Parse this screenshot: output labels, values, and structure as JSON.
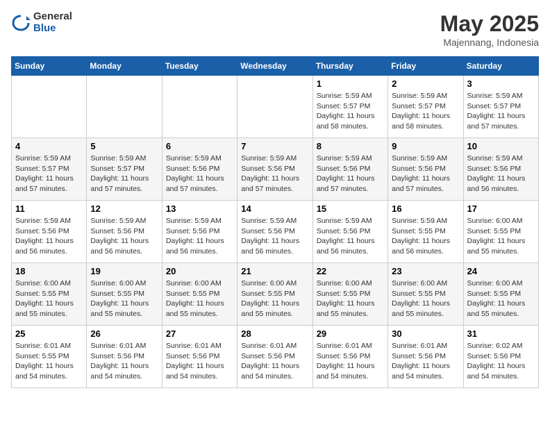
{
  "logo": {
    "general": "General",
    "blue": "Blue"
  },
  "header": {
    "month": "May 2025",
    "location": "Majennang, Indonesia"
  },
  "days_of_week": [
    "Sunday",
    "Monday",
    "Tuesday",
    "Wednesday",
    "Thursday",
    "Friday",
    "Saturday"
  ],
  "weeks": [
    [
      {
        "day": "",
        "info": ""
      },
      {
        "day": "",
        "info": ""
      },
      {
        "day": "",
        "info": ""
      },
      {
        "day": "",
        "info": ""
      },
      {
        "day": "1",
        "info": "Sunrise: 5:59 AM\nSunset: 5:57 PM\nDaylight: 11 hours\nand 58 minutes."
      },
      {
        "day": "2",
        "info": "Sunrise: 5:59 AM\nSunset: 5:57 PM\nDaylight: 11 hours\nand 58 minutes."
      },
      {
        "day": "3",
        "info": "Sunrise: 5:59 AM\nSunset: 5:57 PM\nDaylight: 11 hours\nand 57 minutes."
      }
    ],
    [
      {
        "day": "4",
        "info": "Sunrise: 5:59 AM\nSunset: 5:57 PM\nDaylight: 11 hours\nand 57 minutes."
      },
      {
        "day": "5",
        "info": "Sunrise: 5:59 AM\nSunset: 5:57 PM\nDaylight: 11 hours\nand 57 minutes."
      },
      {
        "day": "6",
        "info": "Sunrise: 5:59 AM\nSunset: 5:56 PM\nDaylight: 11 hours\nand 57 minutes."
      },
      {
        "day": "7",
        "info": "Sunrise: 5:59 AM\nSunset: 5:56 PM\nDaylight: 11 hours\nand 57 minutes."
      },
      {
        "day": "8",
        "info": "Sunrise: 5:59 AM\nSunset: 5:56 PM\nDaylight: 11 hours\nand 57 minutes."
      },
      {
        "day": "9",
        "info": "Sunrise: 5:59 AM\nSunset: 5:56 PM\nDaylight: 11 hours\nand 57 minutes."
      },
      {
        "day": "10",
        "info": "Sunrise: 5:59 AM\nSunset: 5:56 PM\nDaylight: 11 hours\nand 56 minutes."
      }
    ],
    [
      {
        "day": "11",
        "info": "Sunrise: 5:59 AM\nSunset: 5:56 PM\nDaylight: 11 hours\nand 56 minutes."
      },
      {
        "day": "12",
        "info": "Sunrise: 5:59 AM\nSunset: 5:56 PM\nDaylight: 11 hours\nand 56 minutes."
      },
      {
        "day": "13",
        "info": "Sunrise: 5:59 AM\nSunset: 5:56 PM\nDaylight: 11 hours\nand 56 minutes."
      },
      {
        "day": "14",
        "info": "Sunrise: 5:59 AM\nSunset: 5:56 PM\nDaylight: 11 hours\nand 56 minutes."
      },
      {
        "day": "15",
        "info": "Sunrise: 5:59 AM\nSunset: 5:56 PM\nDaylight: 11 hours\nand 56 minutes."
      },
      {
        "day": "16",
        "info": "Sunrise: 5:59 AM\nSunset: 5:55 PM\nDaylight: 11 hours\nand 56 minutes."
      },
      {
        "day": "17",
        "info": "Sunrise: 6:00 AM\nSunset: 5:55 PM\nDaylight: 11 hours\nand 55 minutes."
      }
    ],
    [
      {
        "day": "18",
        "info": "Sunrise: 6:00 AM\nSunset: 5:55 PM\nDaylight: 11 hours\nand 55 minutes."
      },
      {
        "day": "19",
        "info": "Sunrise: 6:00 AM\nSunset: 5:55 PM\nDaylight: 11 hours\nand 55 minutes."
      },
      {
        "day": "20",
        "info": "Sunrise: 6:00 AM\nSunset: 5:55 PM\nDaylight: 11 hours\nand 55 minutes."
      },
      {
        "day": "21",
        "info": "Sunrise: 6:00 AM\nSunset: 5:55 PM\nDaylight: 11 hours\nand 55 minutes."
      },
      {
        "day": "22",
        "info": "Sunrise: 6:00 AM\nSunset: 5:55 PM\nDaylight: 11 hours\nand 55 minutes."
      },
      {
        "day": "23",
        "info": "Sunrise: 6:00 AM\nSunset: 5:55 PM\nDaylight: 11 hours\nand 55 minutes."
      },
      {
        "day": "24",
        "info": "Sunrise: 6:00 AM\nSunset: 5:55 PM\nDaylight: 11 hours\nand 55 minutes."
      }
    ],
    [
      {
        "day": "25",
        "info": "Sunrise: 6:01 AM\nSunset: 5:55 PM\nDaylight: 11 hours\nand 54 minutes."
      },
      {
        "day": "26",
        "info": "Sunrise: 6:01 AM\nSunset: 5:56 PM\nDaylight: 11 hours\nand 54 minutes."
      },
      {
        "day": "27",
        "info": "Sunrise: 6:01 AM\nSunset: 5:56 PM\nDaylight: 11 hours\nand 54 minutes."
      },
      {
        "day": "28",
        "info": "Sunrise: 6:01 AM\nSunset: 5:56 PM\nDaylight: 11 hours\nand 54 minutes."
      },
      {
        "day": "29",
        "info": "Sunrise: 6:01 AM\nSunset: 5:56 PM\nDaylight: 11 hours\nand 54 minutes."
      },
      {
        "day": "30",
        "info": "Sunrise: 6:01 AM\nSunset: 5:56 PM\nDaylight: 11 hours\nand 54 minutes."
      },
      {
        "day": "31",
        "info": "Sunrise: 6:02 AM\nSunset: 5:56 PM\nDaylight: 11 hours\nand 54 minutes."
      }
    ]
  ]
}
